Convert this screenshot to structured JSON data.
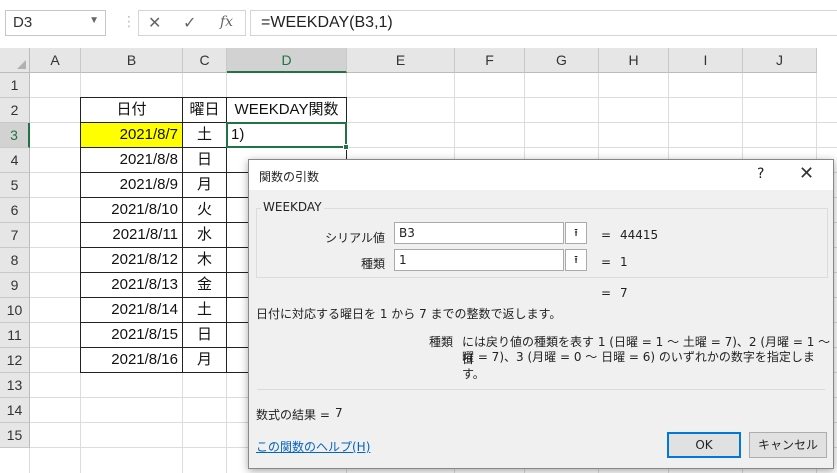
{
  "formula_bar": {
    "name_box": "D3",
    "formula": "=WEEKDAY(B3,1)",
    "cancel_icon": "✕",
    "enter_icon": "✓",
    "fx_label": "fx"
  },
  "columns": [
    "A",
    "B",
    "C",
    "D",
    "E",
    "F",
    "G",
    "H",
    "I",
    "J"
  ],
  "rows": [
    "1",
    "2",
    "3",
    "4",
    "5",
    "6",
    "7",
    "8",
    "9",
    "10",
    "11",
    "12",
    "13",
    "14",
    "15"
  ],
  "table": {
    "headers": [
      "日付",
      "曜日",
      "WEEKDAY関数"
    ],
    "rows": [
      {
        "date": "2021/8/7",
        "day": "土",
        "weekday": "1)"
      },
      {
        "date": "2021/8/8",
        "day": "日",
        "weekday": ""
      },
      {
        "date": "2021/8/9",
        "day": "月",
        "weekday": ""
      },
      {
        "date": "2021/8/10",
        "day": "火",
        "weekday": ""
      },
      {
        "date": "2021/8/11",
        "day": "水",
        "weekday": ""
      },
      {
        "date": "2021/8/12",
        "day": "木",
        "weekday": ""
      },
      {
        "date": "2021/8/13",
        "day": "金",
        "weekday": ""
      },
      {
        "date": "2021/8/14",
        "day": "土",
        "weekday": ""
      },
      {
        "date": "2021/8/15",
        "day": "日",
        "weekday": ""
      },
      {
        "date": "2021/8/16",
        "day": "月",
        "weekday": ""
      }
    ],
    "highlight_color": "#ffff00"
  },
  "dialog": {
    "title": "関数の引数",
    "help_icon": "?",
    "close_icon": "✕",
    "function_name": "WEEKDAY",
    "args": [
      {
        "label": "シリアル値",
        "value": "B3",
        "button_icon": "⭱",
        "eq": "=",
        "result": "44415"
      },
      {
        "label": "種類",
        "value": "1",
        "button_icon": "⭱",
        "eq": "=",
        "result": "1"
      }
    ],
    "result_eq": "=",
    "result_value": "7",
    "description": "日付に対応する曜日を 1 から 7 までの整数で返します。",
    "arg_help_name": "種類",
    "arg_help_line1": "には戻り値の種類を表す 1 (日曜 = 1 ～ 土曜 = 7)、2 (月曜 = 1 ～ 日",
    "arg_help_line2": "曜 = 7)、3 (月曜 = 0 ～ 日曜 = 6) のいずれかの数字を指定します。",
    "formula_result_label": "数式の結果 =",
    "formula_result_value": "7",
    "help_link": "この関数のヘルプ(H)",
    "ok_label": "OK",
    "cancel_label": "キャンセル"
  },
  "colors": {
    "accent": "#217346",
    "link": "#0563c1"
  }
}
